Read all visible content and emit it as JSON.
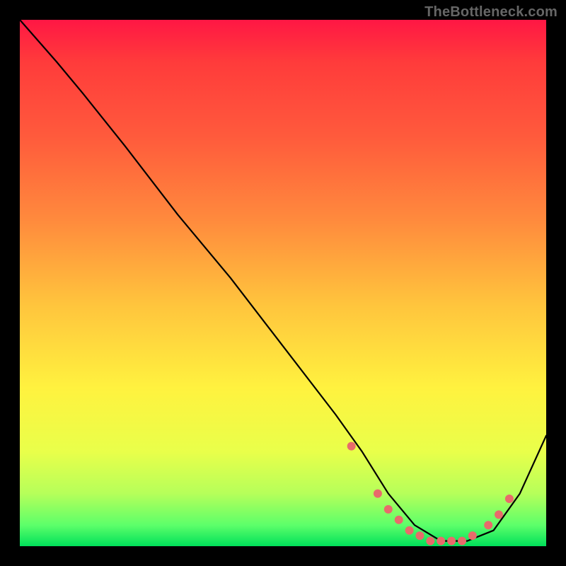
{
  "watermark": "TheBottleneck.com",
  "chart_data": {
    "type": "line",
    "title": "",
    "xlabel": "",
    "ylabel": "",
    "xlim": [
      0,
      100
    ],
    "ylim": [
      0,
      100
    ],
    "series": [
      {
        "name": "bottleneck-curve",
        "x": [
          0,
          7,
          12,
          20,
          30,
          40,
          50,
          60,
          65,
          70,
          75,
          80,
          85,
          90,
          95,
          100
        ],
        "values": [
          100,
          92,
          86,
          76,
          63,
          51,
          38,
          25,
          18,
          10,
          4,
          1,
          1,
          3,
          10,
          21
        ]
      }
    ],
    "markers": {
      "name": "highlight-dots",
      "color": "#e86b6b",
      "x": [
        63,
        68,
        70,
        72,
        74,
        76,
        78,
        80,
        82,
        84,
        86,
        89,
        91,
        93
      ],
      "values": [
        19,
        10,
        7,
        5,
        3,
        2,
        1,
        1,
        1,
        1,
        2,
        4,
        6,
        9
      ]
    }
  }
}
